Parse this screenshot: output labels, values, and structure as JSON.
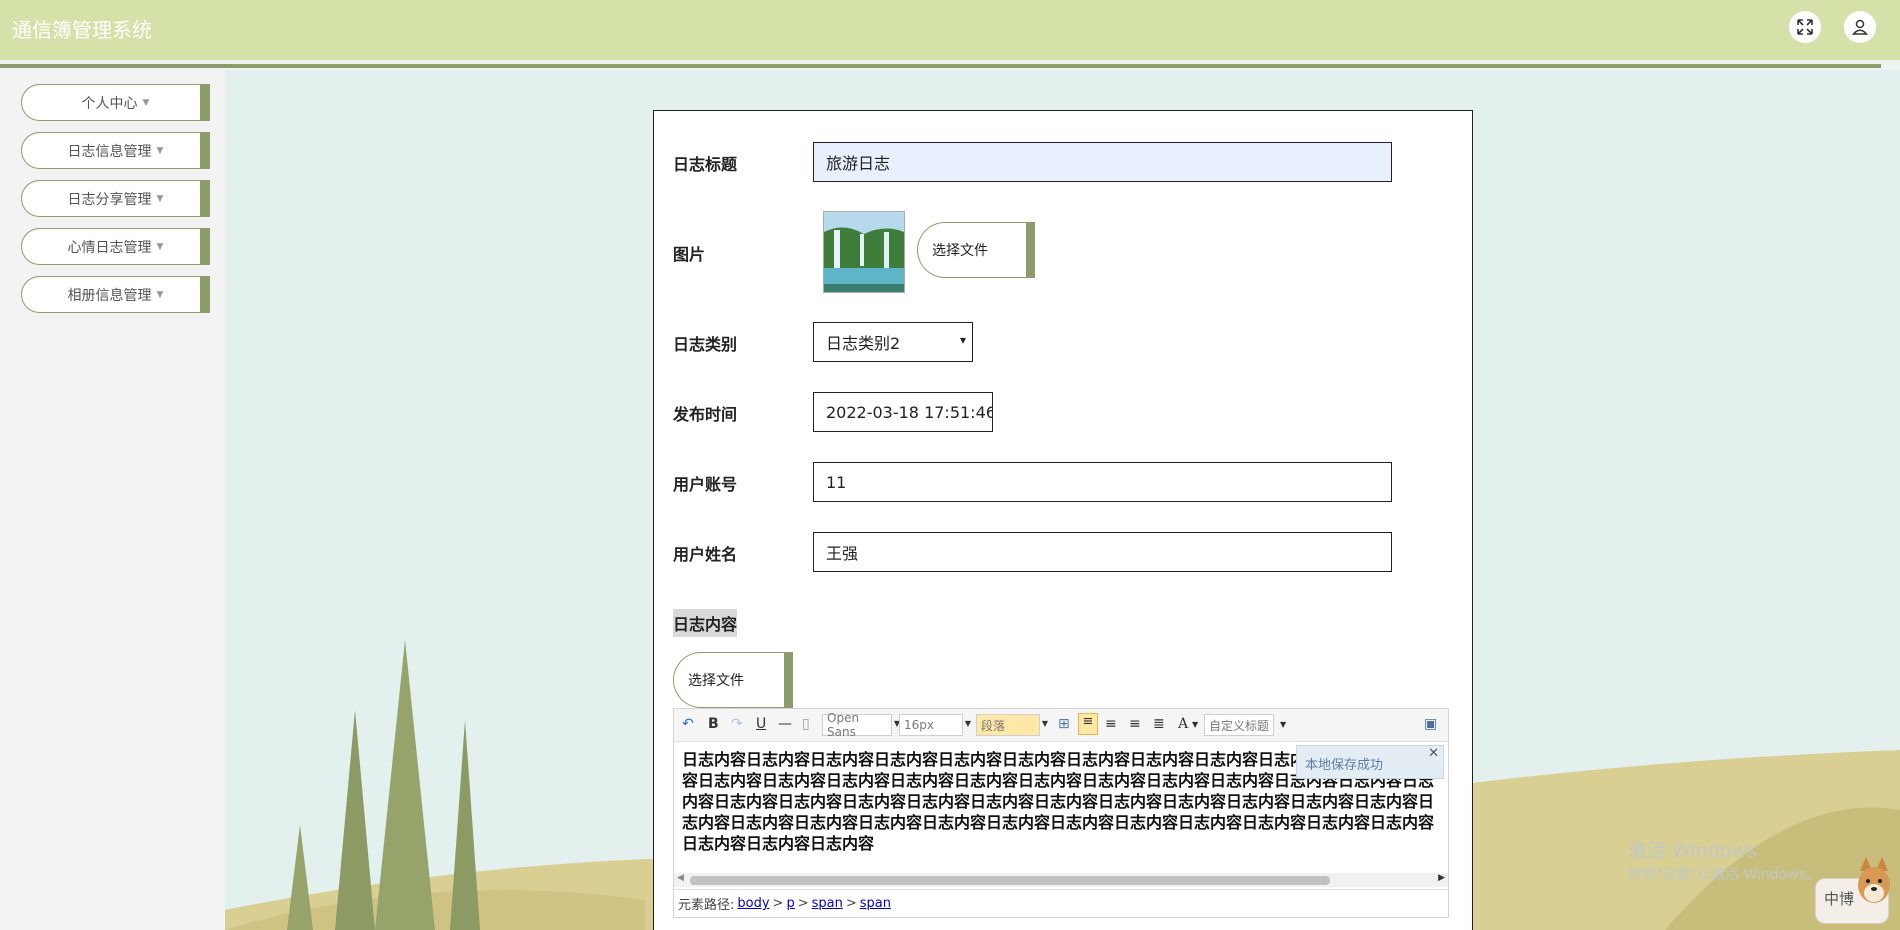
{
  "header": {
    "title": "通信簿管理系统"
  },
  "sidebar": {
    "items": [
      {
        "label": "个人中心"
      },
      {
        "label": "日志信息管理"
      },
      {
        "label": "日志分享管理"
      },
      {
        "label": "心情日志管理"
      },
      {
        "label": "相册信息管理"
      }
    ]
  },
  "form": {
    "title": {
      "label": "日志标题",
      "value": "旅游日志"
    },
    "image": {
      "label": "图片",
      "button": "选择文件"
    },
    "category": {
      "label": "日志类别",
      "value": "日志类别2"
    },
    "publish_time": {
      "label": "发布时间",
      "value": "2022-03-18 17:51:46"
    },
    "account": {
      "label": "用户账号",
      "value": "11"
    },
    "name": {
      "label": "用户姓名",
      "value": "王强"
    },
    "content": {
      "label": "日志内容",
      "button": "选择文件"
    }
  },
  "editor": {
    "font_family": "Open Sans",
    "font_size": "16px",
    "paragraph": "段落",
    "custom_title": "自定义标题",
    "text": "日志内容日志内容日志内容日志内容日志内容日志内容日志内容日志内容日志内容日志内容日志内容日志内容日志内容日志内容日志内容日志内容日志内容日志内容日志内容日志内容日志内容日志内容日志内容日志内容日志内容日志内容日志内容日志内容日志内容日志内容日志内容日志内容日志内容日志内容日志内容日志内容日志内容日志内容日志内容日志内容日志内容日志内容日志内容日志内容日志内容日志内容日志内容日志内容日志内容日志内容",
    "toast": "本地保存成功",
    "path_label": "元素路径:",
    "path": [
      "body",
      "p",
      "span",
      "span"
    ]
  },
  "watermark": {
    "line1": "激活 Windows",
    "line2": "转到\"设置\"以激活 Windows。",
    "badge": "中博"
  }
}
